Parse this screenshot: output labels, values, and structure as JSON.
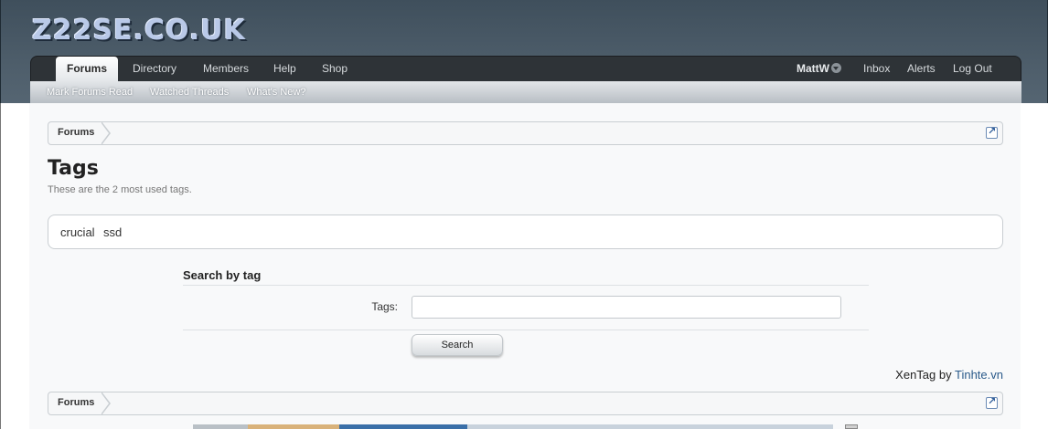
{
  "header": {
    "logo_text": "Z22SE.CO.UK"
  },
  "nav": {
    "tabs": [
      {
        "label": "Forums",
        "active": true
      },
      {
        "label": "Directory"
      },
      {
        "label": "Members"
      },
      {
        "label": "Help"
      },
      {
        "label": "Shop"
      }
    ],
    "user": "MattW",
    "inbox": "Inbox",
    "alerts": "Alerts",
    "logout": "Log Out"
  },
  "subnav": {
    "items": [
      "Mark Forums Read",
      "Watched Threads",
      "What's New?"
    ]
  },
  "breadcrumb": {
    "label": "Forums"
  },
  "page": {
    "title": "Tags",
    "description": "These are the 2 most used tags."
  },
  "tags": [
    "crucial",
    "ssd"
  ],
  "search": {
    "heading": "Search by tag",
    "label": "Tags:",
    "input_value": "",
    "button": "Search"
  },
  "credit": {
    "prefix": "XenTag by",
    "link": "Tinhte.vn"
  },
  "colors": {
    "header_bg": "#4c5c69",
    "navbar_bg": "#2e3337",
    "logo": "#b9c9e8",
    "link": "#2a5a8a"
  }
}
